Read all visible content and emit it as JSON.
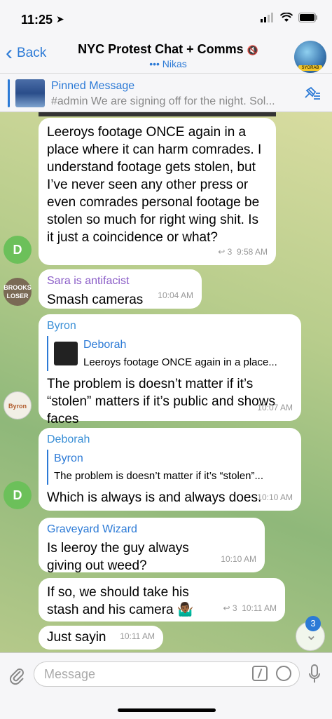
{
  "status": {
    "time": "11:25"
  },
  "header": {
    "back_label": "Back",
    "title": "NYC Protest Chat + Comms",
    "subtitle": "••• Nikas",
    "avatar_badge": "SYGRAB"
  },
  "pinned": {
    "title": "Pinned Message",
    "text": "#admin  We are signing off for the night. Sol..."
  },
  "messages": [
    {
      "text": "Leeroys footage ONCE again in a place where it can harm comrades. I understand footage gets stolen, but I’ve never seen any other press or even comrades personal footage be stolen so much for right wing shit. Is it just a coincidence or what?",
      "replies": "↩ 3",
      "time": "9:58 AM",
      "avatar": "D"
    },
    {
      "sender": "Sara is antifacist",
      "text": "Smash cameras",
      "time": "10:04 AM"
    },
    {
      "sender": "Byron",
      "reply_name": "Deborah",
      "reply_text": "Leeroys footage ONCE again in a place...",
      "text": "The problem is doesn’t matter if it’s “stolen” matters if it’s public and shows faces",
      "time": "10:07 AM"
    },
    {
      "sender": "Deborah",
      "reply_name": "Byron",
      "reply_text": "The problem is doesn’t matter if it’s “stolen”...",
      "text": "Which is always is and always does.",
      "time": "10:10 AM",
      "avatar": "D"
    },
    {
      "sender": "Graveyard Wizard",
      "text": "Is leeroy the guy always giving out weed?",
      "time": "10:10 AM"
    },
    {
      "text": "If so, we should take his stash and his camera 🤷🏾‍♂️",
      "replies": "↩ 3",
      "time": "10:11 AM"
    },
    {
      "text": "Just sayin",
      "time": "10:11 AM"
    }
  ],
  "scroll_badge": "3",
  "input": {
    "placeholder": "Message"
  },
  "colors": {
    "accent": "#2c7ad6",
    "sara": "#8a5cc7",
    "byron": "#3a8fd6",
    "deborah": "#3a8fd6",
    "wizard": "#2c7ad6"
  }
}
